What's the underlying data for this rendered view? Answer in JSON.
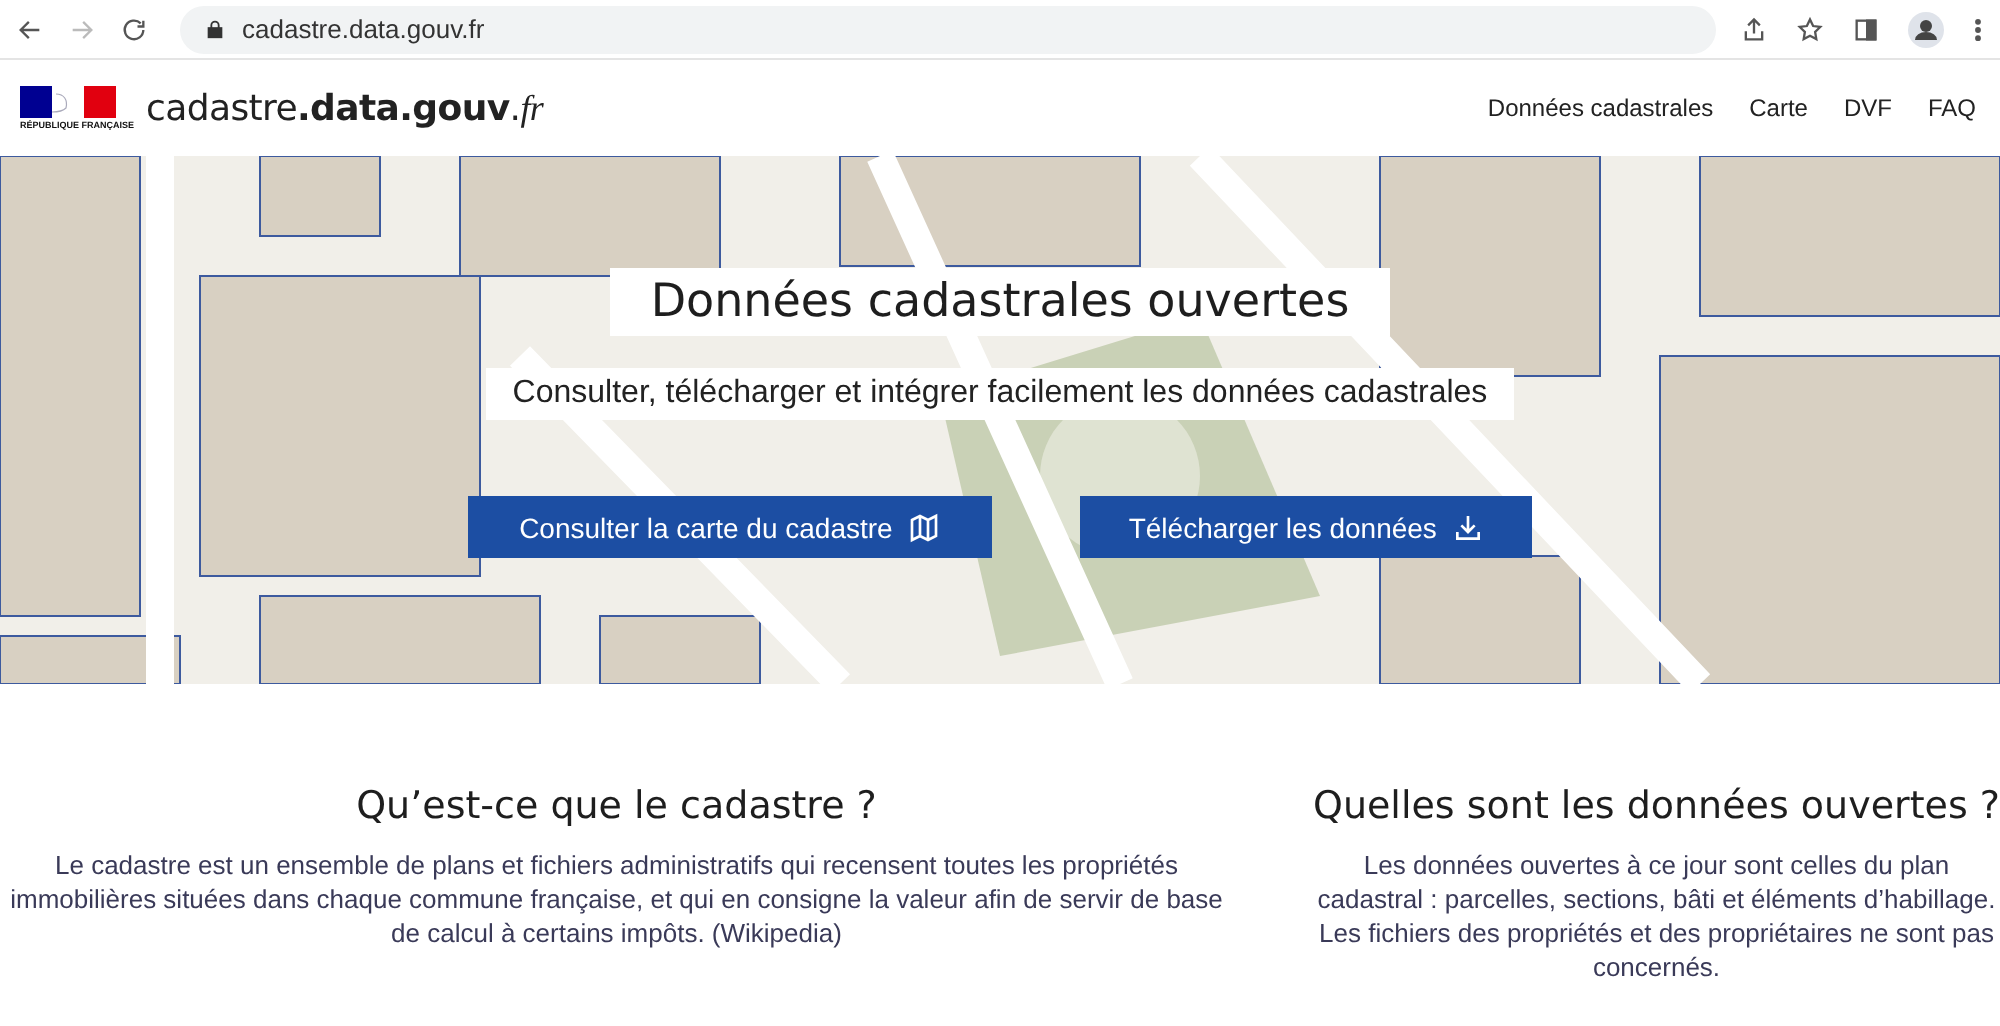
{
  "browser": {
    "url": "cadastre.data.gouv.fr",
    "forward_disabled": true
  },
  "header": {
    "logo_caption": "RÉPUBLIQUE FRANÇAISE",
    "site_name": "cadastre**.data.gouv**.*fr*",
    "nav": [
      {
        "label": "Données cadastrales"
      },
      {
        "label": "Carte"
      },
      {
        "label": "DVF"
      },
      {
        "label": "FAQ"
      }
    ]
  },
  "hero": {
    "title": "Données cadastrales ouvertes",
    "subtitle": "Consulter, télécharger et intégrer facilement les données cadastrales",
    "buttons": [
      {
        "label": "Consulter la carte du cadastre",
        "kind": "map"
      },
      {
        "label": "Télécharger les données",
        "kind": "download"
      }
    ]
  },
  "sections": [
    {
      "heading": "Qu’est-ce que le cadastre ?",
      "text": "Le cadastre est un ensemble de plans et fichiers administratifs qui recensent toutes les propriétés immobilières situées dans chaque commune française, et qui en consigne la valeur afin de servir de base de calcul à certains impôts. (Wikipedia)"
    },
    {
      "heading": "Quelles sont les données ouvertes ?",
      "text": "Les données ouvertes à ce jour sont celles du plan cadastral : parcelles, sections, bâti et éléments d’habillage. Les fichiers des propriétés et des propriétaires ne sont pas concernés."
    }
  ]
}
